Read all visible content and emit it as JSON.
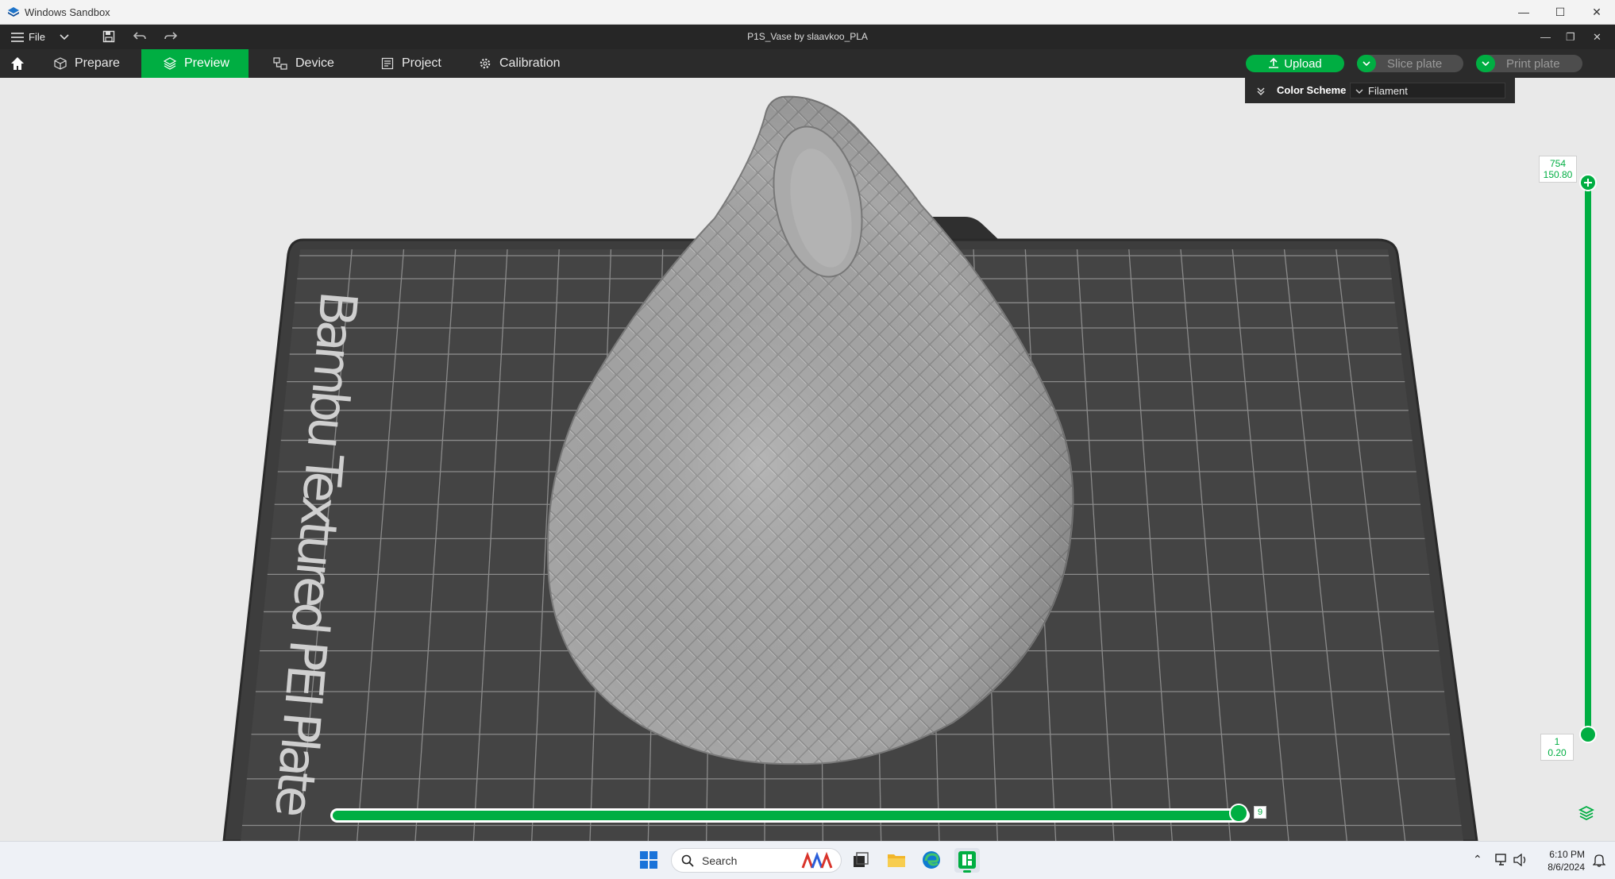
{
  "window": {
    "title": "Windows Sandbox"
  },
  "app": {
    "file_menu": "File",
    "document_title": "P1S_Vase by slaavkoo_PLA"
  },
  "tabs": [
    {
      "label": "Prepare",
      "icon": "cube-icon",
      "active": false
    },
    {
      "label": "Preview",
      "icon": "layers-icon",
      "active": true
    },
    {
      "label": "Device",
      "icon": "device-icon",
      "active": false
    },
    {
      "label": "Project",
      "icon": "document-icon",
      "active": false
    },
    {
      "label": "Calibration",
      "icon": "gear-icon",
      "active": false
    }
  ],
  "actions": {
    "upload": "Upload",
    "slice_plate": "Slice plate",
    "print_plate": "Print plate"
  },
  "color_scheme": {
    "label": "Color Scheme",
    "value": "Filament"
  },
  "plate": {
    "text": "Bambu Textured PEI Plate"
  },
  "layer_slider": {
    "top_layer": "754",
    "top_height": "150.80",
    "bottom_layer": "1",
    "bottom_height": "0.20"
  },
  "move_slider": {
    "value": "9"
  },
  "taskbar": {
    "search_placeholder": "Search",
    "time": "6:10 PM",
    "date": "8/6/2024"
  },
  "colors": {
    "accent": "#00ae42",
    "toolbar": "#262626",
    "plate": "#3f3f3f",
    "model": "#a8a8a8"
  }
}
